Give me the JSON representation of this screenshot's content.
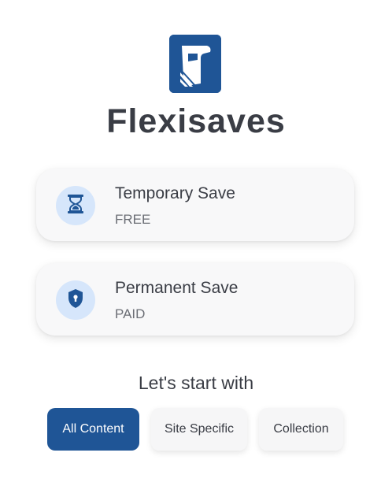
{
  "app": {
    "name": "Flexisaves",
    "logo_icon": "flexisaves-logo-icon",
    "brand_color": "#1f5596"
  },
  "options": [
    {
      "title": "Temporary Save",
      "subtitle": "FREE",
      "icon": "hourglass-icon",
      "icon_bg": "#d6e6fb"
    },
    {
      "title": "Permanent Save",
      "subtitle": "PAID",
      "icon": "shield-lock-icon",
      "icon_bg": "#d6e6fb"
    }
  ],
  "start": {
    "label": "Let's start with",
    "tabs": [
      {
        "label": "All Content",
        "selected": true
      },
      {
        "label": "Site Specific",
        "selected": false
      },
      {
        "label": "Collection",
        "selected": false
      }
    ]
  }
}
